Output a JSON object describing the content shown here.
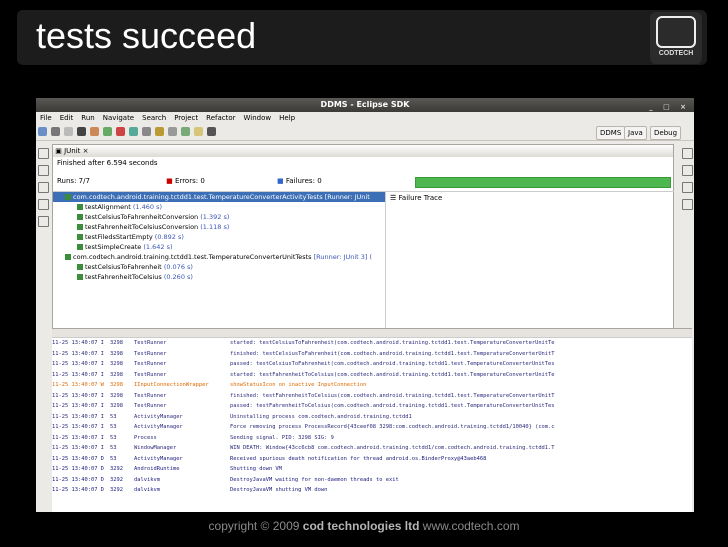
{
  "slide_title": "tests succeed",
  "logo": {
    "label": "CODTECH"
  },
  "window": {
    "title": "DDMS - Eclipse SDK"
  },
  "menu": [
    "File",
    "Edit",
    "Run",
    "Navigate",
    "Search",
    "Project",
    "Refactor",
    "Window",
    "Help"
  ],
  "perspectives": [
    "DDMS",
    "Java",
    "Debug"
  ],
  "junit": {
    "tab_label": "JUnit",
    "status": "Finished after 6.594 seconds",
    "runs_label": "Runs:",
    "runs_value": "7/7",
    "errors_label": "Errors:",
    "errors_value": "0",
    "failures_label": "Failures:",
    "failures_value": "0",
    "failure_trace_label": "Failure Trace",
    "tree": [
      {
        "name": "com.codtech.android.training.tctdd1.test.TemperatureConverterActivityTests [Runner: JUnit",
        "time": "",
        "indent": 1,
        "selected": true
      },
      {
        "name": "testAlignment",
        "time": "(1.460 s)",
        "indent": 2
      },
      {
        "name": "testCelsiusToFahrenheitConversion",
        "time": "(1.392 s)",
        "indent": 2
      },
      {
        "name": "testFahrenheitToCelsiusConversion",
        "time": "(1.118 s)",
        "indent": 2
      },
      {
        "name": "testFiledsStartEmpty",
        "time": "(0.892 s)",
        "indent": 2
      },
      {
        "name": "testSimpleCreate",
        "time": "(1.642 s)",
        "indent": 2
      },
      {
        "name": "com.codtech.android.training.tctdd1.test.TemperatureConverterUnitTests",
        "time": "[Runner: JUnit 3] (",
        "indent": 1
      },
      {
        "name": "testCelsiusToFahrenheit",
        "time": "(0.076 s)",
        "indent": 2
      },
      {
        "name": "testFahrenheitToCelsius",
        "time": "(0.260 s)",
        "indent": 2
      }
    ]
  },
  "log": [
    {
      "t": "11-25 13:40:07 I",
      "pid": "3298",
      "tag": "TestRunner",
      "msg": "started: testCelsiusToFahrenheit(com.codtech.android.training.tctdd1.test.TemperatureConverterUnitTe",
      "lvl": "info"
    },
    {
      "t": "11-25 13:40:07 I",
      "pid": "3298",
      "tag": "TestRunner",
      "msg": "finished: testCelsiusToFahrenheit(com.codtech.android.training.tctdd1.test.TemperatureConverterUnitT",
      "lvl": "info"
    },
    {
      "t": "11-25 13:40:07 I",
      "pid": "3298",
      "tag": "TestRunner",
      "msg": "passed: testCelsiusToFahrenheit(com.codtech.android.training.tctdd1.test.TemperatureConverterUnitTes",
      "lvl": "info"
    },
    {
      "t": "11-25 13:40:07 I",
      "pid": "3298",
      "tag": "TestRunner",
      "msg": "started: testFahrenheitToCelsius(com.codtech.android.training.tctdd1.test.TemperatureConverterUnitTe",
      "lvl": "info"
    },
    {
      "t": "11-25 13:40:07 W",
      "pid": "3298",
      "tag": "IInputConnectionWrapper",
      "msg": "showStatusIcon on inactive InputConnection",
      "lvl": "warn"
    },
    {
      "t": "11-25 13:40:07 I",
      "pid": "3298",
      "tag": "TestRunner",
      "msg": "finished: testFahrenheitToCelsius(com.codtech.android.training.tctdd1.test.TemperatureConverterUnitT",
      "lvl": "info"
    },
    {
      "t": "11-25 13:40:07 I",
      "pid": "3298",
      "tag": "TestRunner",
      "msg": "passed: testFahrenheitToCelsius(com.codtech.android.training.tctdd1.test.TemperatureConverterUnitTes",
      "lvl": "info"
    },
    {
      "t": "11-25 13:40:07 I",
      "pid": "53",
      "tag": "ActivityManager",
      "msg": "Uninstalling process com.codtech.android.training.tctdd1",
      "lvl": "info"
    },
    {
      "t": "11-25 13:40:07 I",
      "pid": "53",
      "tag": "ActivityManager",
      "msg": "Force removing process ProcessRecord{43ceef08 3298:com.codtech.android.training.tctdd1/10040} (com.c",
      "lvl": "info"
    },
    {
      "t": "11-25 13:40:07 I",
      "pid": "53",
      "tag": "Process",
      "msg": "Sending signal. PID: 3298 SIG: 9",
      "lvl": "info"
    },
    {
      "t": "11-25 13:40:07 I",
      "pid": "53",
      "tag": "WindowManager",
      "msg": "WIN DEATH: Window{43cc6cb8 com.codtech.android.training.tctdd1/com.codtech.android.training.tctdd1.T",
      "lvl": "info"
    },
    {
      "t": "11-25 13:40:07 D",
      "pid": "53",
      "tag": "ActivityManager",
      "msg": "Received spurious death notification for thread android.os.BinderProxy@43aeb468",
      "lvl": "dbg"
    },
    {
      "t": "11-25 13:40:07 D",
      "pid": "3292",
      "tag": "AndroidRuntime",
      "msg": "Shutting down VM",
      "lvl": "dbg"
    },
    {
      "t": "11-25 13:40:07 D",
      "pid": "3292",
      "tag": "dalvikvm",
      "msg": "DestroyJavaVM waiting for non-daemon threads to exit",
      "lvl": "dbg"
    },
    {
      "t": "11-25 13:40:07 D",
      "pid": "3292",
      "tag": "dalvikvm",
      "msg": "DestroyJavaVM shutting VM down",
      "lvl": "dbg"
    }
  ],
  "footer": {
    "pre": "copyright © 2009",
    "company": "cod technologies ltd",
    "url": "www.codtech.com"
  }
}
